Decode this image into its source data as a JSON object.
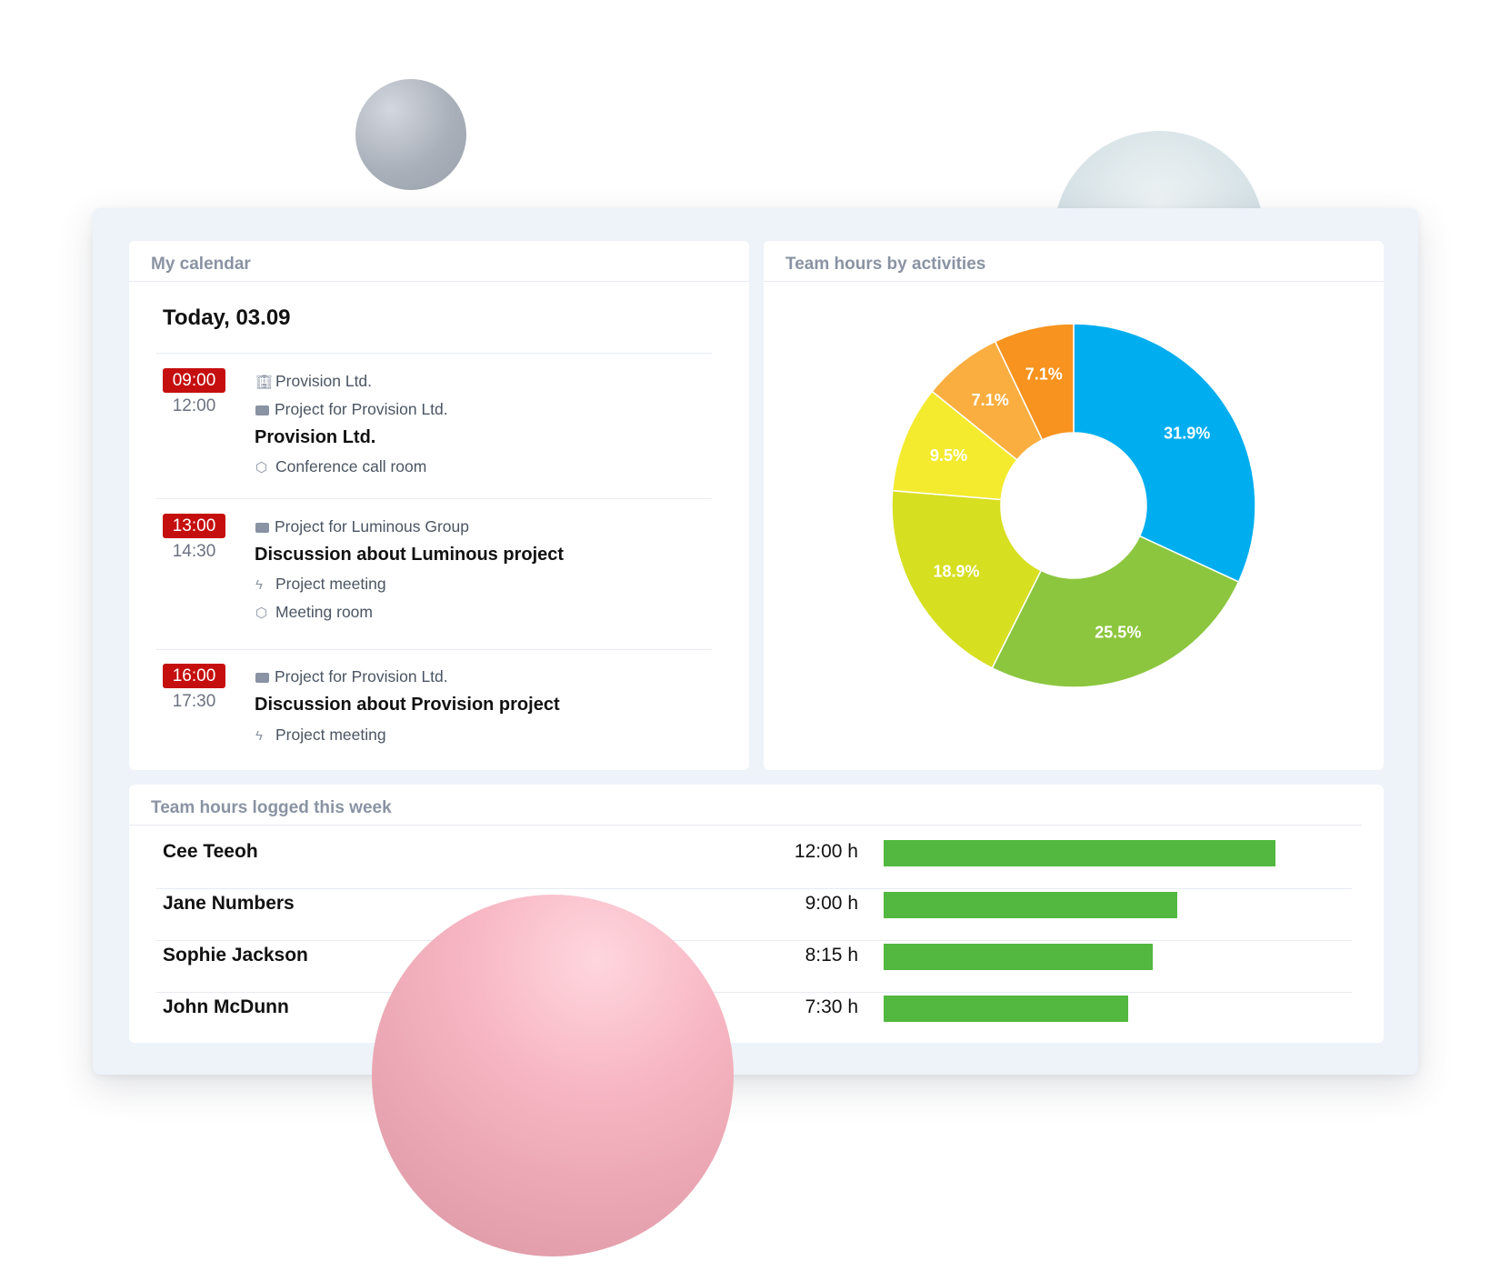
{
  "calendar": {
    "title": "My calendar",
    "today": "Today, 03.09",
    "events": [
      {
        "start": "09:00",
        "end": "12:00",
        "company": "Provision Ltd.",
        "project": "Project for Provision Ltd.",
        "title": "Provision Ltd.",
        "room": "Conference call room"
      },
      {
        "start": "13:00",
        "end": "14:30",
        "project": "Project for Luminous Group",
        "title": "Discussion about Luminous project",
        "activity": "Project meeting",
        "room": "Meeting room"
      },
      {
        "start": "16:00",
        "end": "17:30",
        "project": "Project for Provision Ltd.",
        "title": "Discussion about Provision project",
        "activity": "Project meeting"
      }
    ]
  },
  "activities": {
    "title": "Team hours by activities"
  },
  "chart_data": {
    "type": "pie",
    "donut": true,
    "title": "Team hours by activities",
    "slices": [
      {
        "value": 31.9,
        "label": "31.9%",
        "color": "#00aeef"
      },
      {
        "value": 25.5,
        "label": "25.5%",
        "color": "#8cc63f"
      },
      {
        "value": 18.9,
        "label": "18.9%",
        "color": "#d7df21"
      },
      {
        "value": 9.5,
        "label": "9.5%",
        "color": "#f4eb2f"
      },
      {
        "value": 7.1,
        "label": "7.1%",
        "color": "#fbae40"
      },
      {
        "value": 7.1,
        "label": "7.1%",
        "color": "#f7931e"
      }
    ]
  },
  "hours": {
    "title": "Team hours logged this week",
    "max_hours": 12,
    "rows": [
      {
        "name": "Cee Teeoh",
        "value": "12:00 h",
        "hours": 12.0
      },
      {
        "name": "Jane Numbers",
        "value": "9:00 h",
        "hours": 9.0
      },
      {
        "name": "Sophie Jackson",
        "value": "8:15 h",
        "hours": 8.25
      },
      {
        "name": "John McDunn",
        "value": "7:30 h",
        "hours": 7.5
      }
    ],
    "bar_color": "#52b840"
  }
}
